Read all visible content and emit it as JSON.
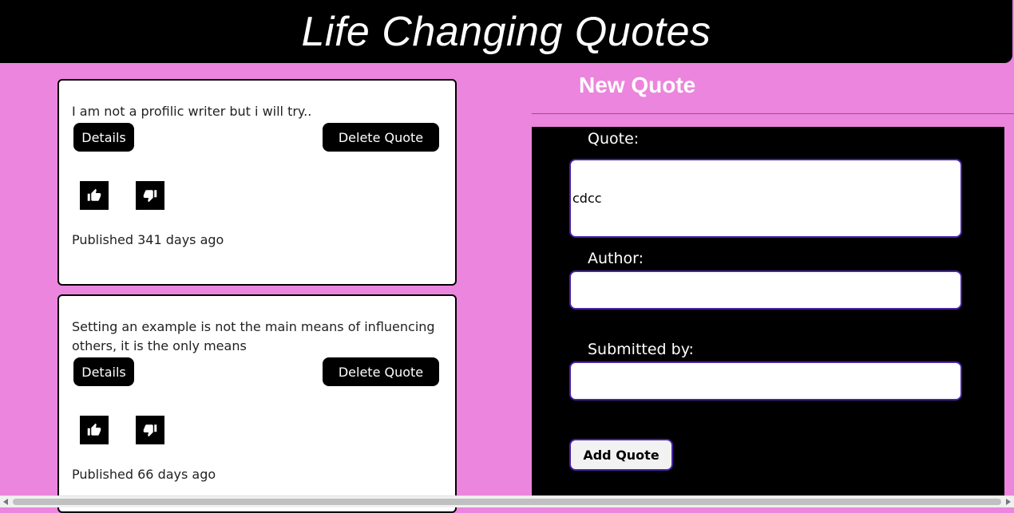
{
  "header": {
    "title": "Life Changing Quotes"
  },
  "quotes": [
    {
      "text": "I am not a profilic writer but i will try..",
      "details_label": "Details",
      "delete_label": "Delete Quote",
      "published": "Published 341 days ago"
    },
    {
      "text": "Setting an example is not the main means of influencing others, it is the only means",
      "details_label": "Details",
      "delete_label": "Delete Quote",
      "published": "Published 66 days ago"
    }
  ],
  "form": {
    "title": "New Quote",
    "quote_label": "Quote:",
    "quote_value": "cdcc",
    "author_label": "Author:",
    "author_value": "",
    "submitted_label": "Submitted by:",
    "submitted_value": "",
    "submit_label": "Add Quote"
  },
  "icons": {
    "upvote": "thumbs-up-icon",
    "downvote": "thumbs-down-icon",
    "scroll_left": "triangle-left-icon",
    "scroll_right": "triangle-right-icon"
  },
  "colors": {
    "page_background": "#ec85dd",
    "header_background": "#000000",
    "input_border": "#4b22a8"
  }
}
